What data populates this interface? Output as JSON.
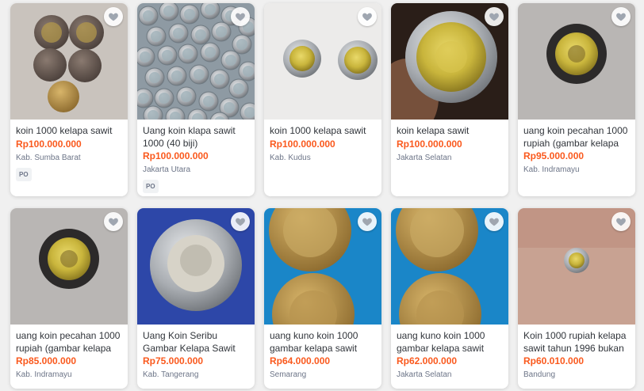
{
  "products": [
    {
      "title": "koin 1000 kelapa sawit",
      "price": "Rp100.000.000",
      "location": "Kab. Sumba Barat",
      "badge": "PO",
      "photo": "five-coins-dark",
      "wishlist_icon": "heart-icon"
    },
    {
      "title": "Uang koin klapa sawit 1000 (40 biji)",
      "price": "Rp100.000.000",
      "location": "Jakarta Utara",
      "badge": "PO",
      "photo": "pile-of-coins",
      "wishlist_icon": "heart-icon"
    },
    {
      "title": "koin 1000 kelapa sawit",
      "price": "Rp100.000.000",
      "location": "Kab. Kudus",
      "badge": "",
      "photo": "two-coins-white",
      "wishlist_icon": "heart-icon"
    },
    {
      "title": "koin kelapa sawit",
      "price": "Rp100.000.000",
      "location": "Jakarta Selatan",
      "badge": "",
      "photo": "coin-in-hand",
      "wishlist_icon": "heart-icon"
    },
    {
      "title": "uang koin pecahan 1000 rupiah (gambar kelapa",
      "price": "Rp95.000.000",
      "location": "Kab. Indramayu",
      "badge": "",
      "photo": "coin-reverse-gray",
      "wishlist_icon": "heart-icon"
    },
    {
      "title": "uang koin pecahan 1000 rupiah (gambar kelapa",
      "price": "Rp85.000.000",
      "location": "Kab. Indramayu",
      "badge": "",
      "photo": "coin-reverse-gray",
      "wishlist_icon": "heart-icon"
    },
    {
      "title": "Uang Koin Seribu Gambar Kelapa Sawit",
      "price": "Rp75.000.000",
      "location": "Kab. Tangerang",
      "badge": "",
      "photo": "coin-on-blue",
      "wishlist_icon": "heart-icon"
    },
    {
      "title": "uang kuno koin 1000 gambar kelapa sawit",
      "price": "Rp64.000.000",
      "location": "Semarang",
      "badge": "",
      "photo": "two-coins-blue",
      "wishlist_icon": "heart-icon"
    },
    {
      "title": "uang kuno koin 1000 gambar kelapa sawit",
      "price": "Rp62.000.000",
      "location": "Jakarta Selatan",
      "badge": "",
      "photo": "two-coins-blue",
      "wishlist_icon": "heart-icon"
    },
    {
      "title": "Koin 1000 rupiah kelapa sawit tahun 1996 bukan",
      "price": "Rp60.010.000",
      "location": "Bandung",
      "badge": "",
      "photo": "small-coin-table",
      "wishlist_icon": "heart-icon"
    }
  ],
  "colors": {
    "price": "#fa591d",
    "title": "#31353b",
    "location": "#6d7588",
    "heart": "#9fa6b0"
  }
}
